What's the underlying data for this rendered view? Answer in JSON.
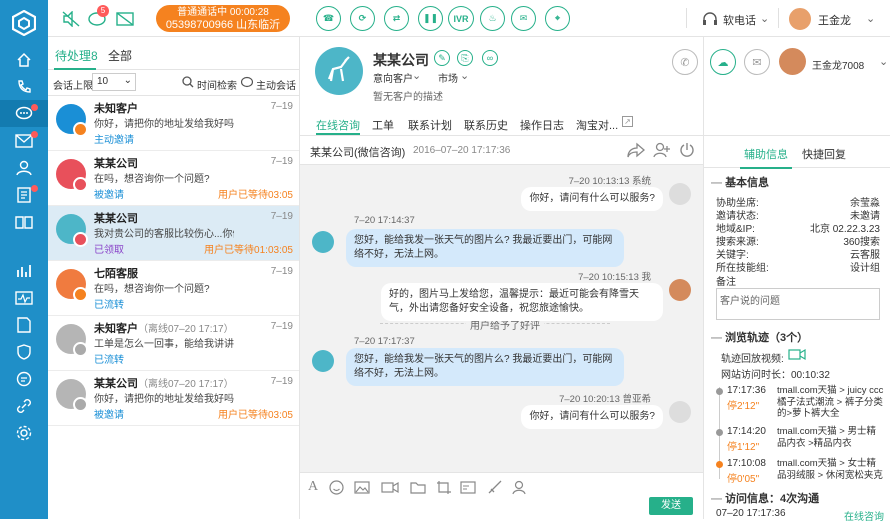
{
  "topbar": {
    "call_badge_count": "5",
    "call_status": "普通通话中 00:00:28",
    "call_number": "05398700966 山东临沂",
    "ivr_label": "IVR",
    "phone_mode": "软电话",
    "user_name": "王金龙"
  },
  "left": {
    "tab_pending": "待处理8",
    "tab_all": "全部",
    "limit_label": "会话上限",
    "limit_value": "10",
    "time_search": "时间检索",
    "auto_chat": "主动会话",
    "items": [
      {
        "name": "未知客户",
        "sub": "",
        "time": "7–19",
        "msg": "你好，请把你的地址发给我好吗?",
        "status": "主动邀请",
        "wait": ""
      },
      {
        "name": "某某公司",
        "sub": "",
        "time": "7–19",
        "msg": "在吗，想咨询你一个问题?",
        "status": "被邀请",
        "wait": "用户已等待03:05"
      },
      {
        "name": "某某公司",
        "sub": "",
        "time": "7–19",
        "msg": "我对贵公司的客服比较伤心...你们",
        "status": "已领取",
        "wait": "用户已等待01:03:05"
      },
      {
        "name": "七陌客服",
        "sub": "",
        "time": "7–19",
        "msg": "在吗，想咨询你一个问题?",
        "status": "已流转",
        "wait": ""
      },
      {
        "name": "未知客户",
        "sub": "（离线07–20  17:17）",
        "time": "7–19",
        "msg": "工单是怎么一回事，能给我讲讲吗?",
        "status": "已流转",
        "wait": ""
      },
      {
        "name": "某某公司",
        "sub": "（离线07–20 17:17）",
        "time": "7–19",
        "msg": "你好，请把你的地址发给我好吗?",
        "status": "被邀请",
        "wait": "用户已等待03:05"
      }
    ]
  },
  "customer": {
    "name": "某某公司",
    "intent": "意向客户",
    "source": "市场",
    "desc": "暂无客户的描述",
    "agent": "王金龙7008"
  },
  "subtabs": [
    "在线咨询",
    "工单",
    "联系计划",
    "联系历史",
    "操作日志",
    "淘宝对..."
  ],
  "chat": {
    "title": "某某公司(微信咨询)",
    "time": "2016–07–20 17:17:36",
    "messages": [
      {
        "dir": "out",
        "meta": "7–20  10:13:13  系统",
        "text": "你好，请问有什么可以服务?"
      },
      {
        "dir": "in",
        "meta": "7–20 17:14:37",
        "text": "您好，能给我发一张天气的图片么? 我最近要出门，可能网络不好，无法上网。"
      },
      {
        "dir": "out",
        "meta": "7–20  10:15:13  我",
        "text": "好的，图片马上发给您，温馨提示：最近可能会有降雪天气，外出请您备好安全设备，祝您旅途愉快。"
      },
      {
        "dir": "in",
        "meta": "7–20 17:17:37",
        "text": "您好，能给我发一张天气的图片么? 我最近要出门，可能网络不好，无法上网。"
      },
      {
        "dir": "out",
        "meta": "7–20  10:20:13  曾亚希",
        "text": "你好，请问有什么可以服务?"
      }
    ],
    "divider": "用户给予了好评",
    "send": "发送"
  },
  "right": {
    "tab_assist": "辅助信息",
    "tab_quick": "快捷回复",
    "basic_title": "基本信息",
    "fields": [
      {
        "k": "协助坐席:",
        "v": "余莹淼"
      },
      {
        "k": "邀请状态:",
        "v": "未邀请"
      },
      {
        "k": "地域&IP:",
        "v": "北京  02.22.3.23"
      },
      {
        "k": "搜索来源:",
        "v": "360搜索"
      },
      {
        "k": "关键字:",
        "v": "云客服"
      },
      {
        "k": "所在技能组:",
        "v": "设计组"
      }
    ],
    "remark_label": "备注",
    "remark_placeholder": "客户说的问题",
    "track_title": "浏览轨迹（3个）",
    "replay_label": "轨迹回放视频:",
    "duration": "网站访问时长：00:10:32",
    "tracks": [
      {
        "time": "17:17:36",
        "stay": "停2'12\"",
        "path": "tmall.com天猫 > juicy ccc橘子法式潮流 > 裤子分类的>萝卜裤大全"
      },
      {
        "time": "17:14:20",
        "stay": "停1'12\"",
        "path": "tmall.com天猫 > 男士精品内衣 >精品内衣"
      },
      {
        "time": "17:10:08",
        "stay": "停0'05\"",
        "path": "tmall.com天猫 > 女士精品羽绒服 > 休闲宽松夹克"
      }
    ],
    "visit_title": "访问信息：4次沟通",
    "visit_time": "07–20  17:17:36",
    "visit_status": "在线咨询"
  }
}
